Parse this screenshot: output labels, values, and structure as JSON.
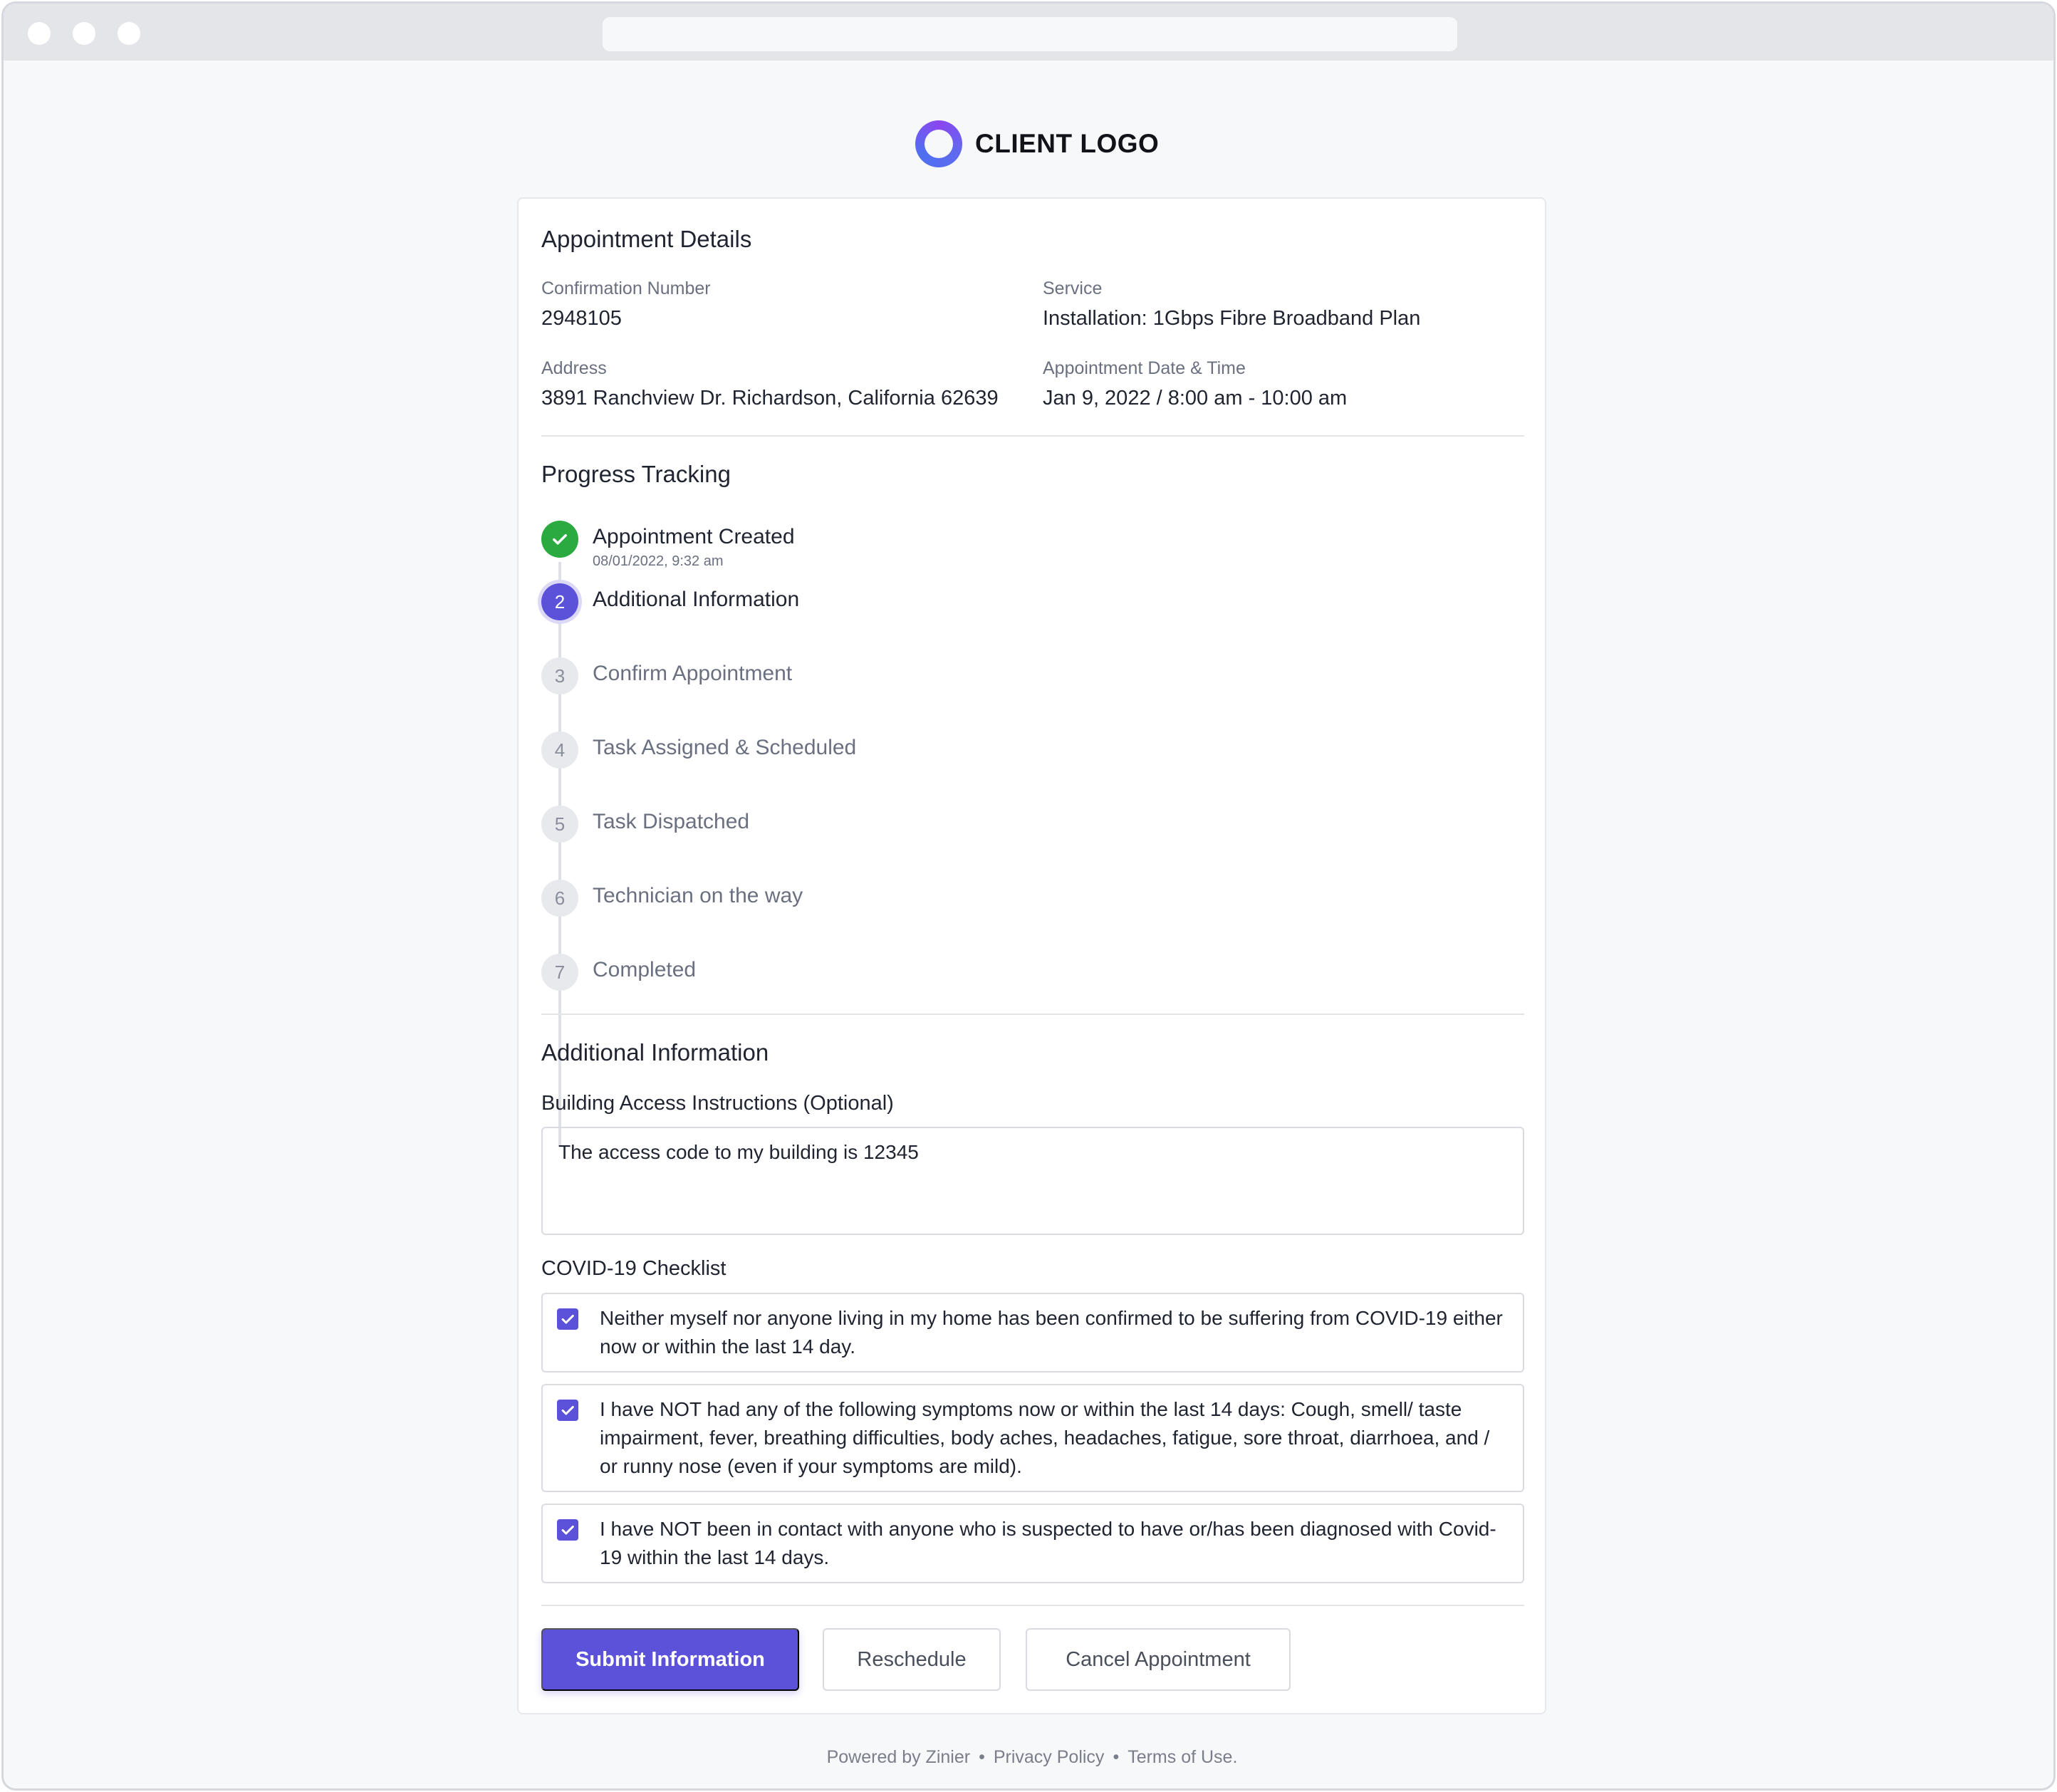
{
  "logo": {
    "text": "CLIENT LOGO"
  },
  "appointment": {
    "title": "Appointment Details",
    "confirmation_label": "Confirmation Number",
    "confirmation_value": "2948105",
    "service_label": "Service",
    "service_value": "Installation: 1Gbps Fibre Broadband Plan",
    "address_label": "Address",
    "address_value": "3891 Ranchview Dr. Richardson, California 62639",
    "datetime_label": "Appointment Date & Time",
    "datetime_value": "Jan 9, 2022 / 8:00 am - 10:00 am"
  },
  "progress": {
    "title": "Progress Tracking",
    "steps": [
      {
        "number": "1",
        "label": "Appointment Created",
        "sub": "08/01/2022, 9:32 am",
        "state": "done"
      },
      {
        "number": "2",
        "label": "Additional Information",
        "state": "current"
      },
      {
        "number": "3",
        "label": "Confirm Appointment",
        "state": "pending"
      },
      {
        "number": "4",
        "label": "Task Assigned & Scheduled",
        "state": "pending"
      },
      {
        "number": "5",
        "label": "Task Dispatched",
        "state": "pending"
      },
      {
        "number": "6",
        "label": "Technician on the way",
        "state": "pending"
      },
      {
        "number": "7",
        "label": "Completed",
        "state": "pending"
      }
    ]
  },
  "additional": {
    "title": "Additional Information",
    "access_label": "Building Access Instructions (Optional)",
    "access_value": "The access code to my building is 12345",
    "checklist_label": "COVID-19 Checklist",
    "checklist": [
      {
        "text": "Neither myself nor anyone living in my home has been confirmed to be suffering from COVID-19 either now or within the last 14 day.",
        "checked": true
      },
      {
        "text": "I have NOT had any of the following symptoms now or within the last 14 days: Cough, smell/ taste impairment, fever, breathing difficulties, body aches, headaches, fatigue, sore throat, diarrhoea, and / or runny nose (even if your symptoms are mild).",
        "checked": true
      },
      {
        "text": "I have NOT been in contact with anyone who is suspected to have or/has been diagnosed with Covid-19 within the last 14 days.",
        "checked": true
      }
    ]
  },
  "actions": {
    "submit": "Submit Information",
    "reschedule": "Reschedule",
    "cancel": "Cancel Appointment"
  },
  "footer": {
    "powered": "Powered by Zinier",
    "privacy": "Privacy Policy",
    "terms": "Terms of Use.",
    "separator": "•"
  },
  "colors": {
    "accent": "#5b52d9",
    "success": "#2aaa3f"
  }
}
